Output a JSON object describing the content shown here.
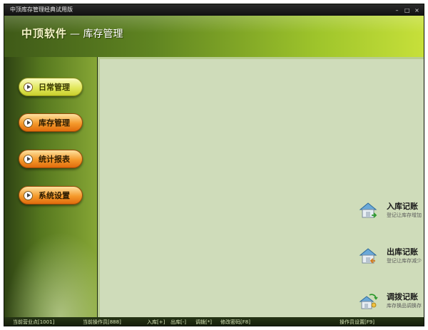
{
  "window": {
    "title": "中顶库存管理经典试用版",
    "controls": [
      "minimize",
      "maximize",
      "close"
    ]
  },
  "banner": {
    "brand": "中顶软件",
    "subtitle": "— 库存管理"
  },
  "nav": [
    {
      "label": "日常管理",
      "style": "yellow"
    },
    {
      "label": "库存管理",
      "style": "orange"
    },
    {
      "label": "统计报表",
      "style": "orange"
    },
    {
      "label": "系统设置",
      "style": "orange"
    }
  ],
  "quick_actions": [
    {
      "title": "入库记账",
      "desc": "登记让库存增加",
      "icon": "warehouse-in-icon"
    },
    {
      "title": "出库记账",
      "desc": "登记让库存减少",
      "icon": "warehouse-out-icon"
    },
    {
      "title": "调拨记账",
      "desc": "库存换品调换存",
      "icon": "transfer-icon"
    }
  ],
  "statusbar": {
    "store": "当前营业点[1001]",
    "operator": "当前操作员[888]",
    "inbound": "入库[+]",
    "outbound": "出库[-]",
    "transfer": "调拨[*]",
    "password": "修改密码[F8]",
    "operator_settings": "操作员设置[F9]"
  },
  "colors": {
    "banner_dark": "#3f5a18",
    "banner_light": "#c7e03a",
    "content_bg": "#cfdcba",
    "nav_yellow": "#e2e85e",
    "nav_orange": "#f59a2c"
  }
}
